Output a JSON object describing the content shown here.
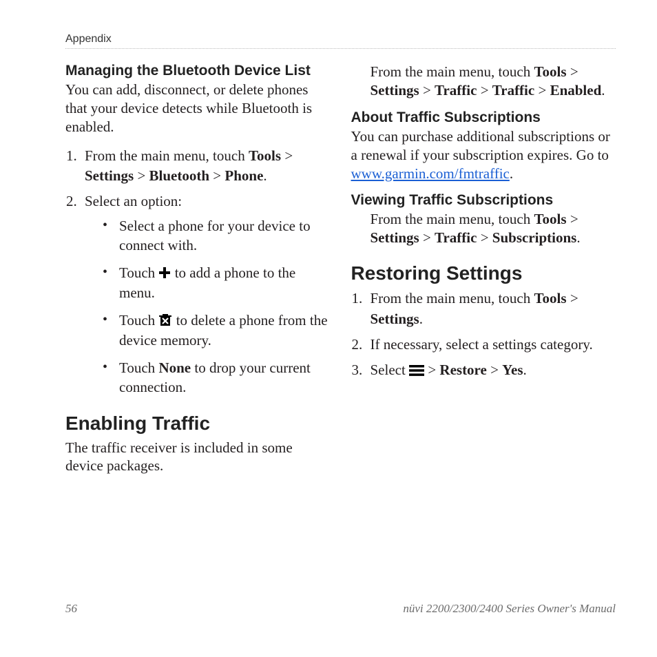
{
  "header": {
    "section": "Appendix"
  },
  "left": {
    "h_bluetooth": "Managing the Bluetooth Device List",
    "p_bluetooth": "You can add, disconnect, or delete phones that your device detects while Bluetooth is enabled.",
    "step1_pre": "From the main menu, touch ",
    "step1_b1": "Tools",
    "gt": " > ",
    "step1_b2": "Settings",
    "step1_b3": "Bluetooth",
    "step1_b4": "Phone",
    "period": ".",
    "step2": "Select an option:",
    "bullet1": "Select a phone for your device to connect with.",
    "bullet2_pre": "Touch ",
    "bullet2_post": " to add a phone to the menu.",
    "bullet3_pre": "Touch ",
    "bullet3_post": " to delete a phone from the device memory.",
    "bullet4_pre": "Touch ",
    "bullet4_b": "None",
    "bullet4_post": " to drop your current connection.",
    "h_traffic": "Enabling Traffic",
    "p_traffic": "The traffic receiver is included in some device packages."
  },
  "right": {
    "intro_pre": "From the main menu, touch ",
    "b_tools": "Tools",
    "b_settings": "Settings",
    "b_traffic": "Traffic",
    "b_enabled": "Enabled",
    "h_subs": "About Traffic Subscriptions",
    "p_subs": "You can purchase additional subscriptions or a renewal if your subscription expires. Go to ",
    "link_subs": "www.garmin.com/fmtraffic",
    "h_view": "Viewing Traffic Subscriptions",
    "view_pre": "From the main menu, touch ",
    "b_subscriptions": "Subscriptions",
    "h_restore": "Restoring Settings",
    "r1_pre": "From the main menu, touch ",
    "r2": "If necessary, select a settings category.",
    "r3_pre": "Select ",
    "b_restore": "Restore",
    "b_yes": "Yes"
  },
  "footer": {
    "page": "56",
    "title": "nüvi 2200/2300/2400 Series Owner's Manual"
  }
}
